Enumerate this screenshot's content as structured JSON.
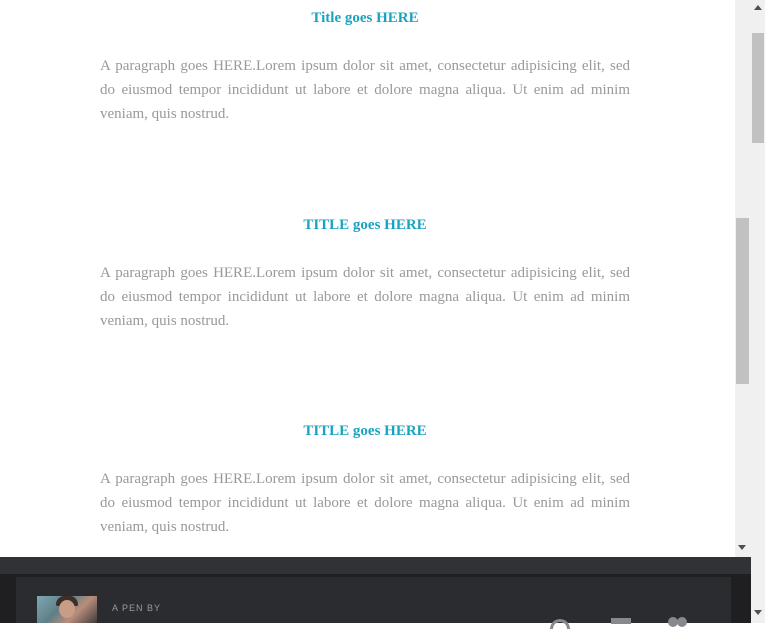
{
  "sections": [
    {
      "title": "Title goes HERE",
      "paragraph": "A paragraph goes HERE.Lorem ipsum dolor sit amet, consectetur adipisicing elit, sed do eiusmod tempor incididunt ut labore et dolore magna aliqua. Ut enim ad minim veniam, quis nostrud."
    },
    {
      "title": "TITLE goes HERE",
      "paragraph": "A paragraph goes HERE.Lorem ipsum dolor sit amet, consectetur adipisicing elit, sed do eiusmod tempor incididunt ut labore et dolore magna aliqua. Ut enim ad minim veniam, quis nostrud."
    },
    {
      "title": "TITLE goes HERE",
      "paragraph": "A paragraph goes HERE.Lorem ipsum dolor sit amet, consectetur adipisicing elit, sed do eiusmod tempor incididunt ut labore et dolore magna aliqua. Ut enim ad minim veniam, quis nostrud."
    }
  ],
  "footer": {
    "pen_by_label": "A PEN BY"
  },
  "colors": {
    "title": "#1aa3c0",
    "paragraph": "#999999",
    "footer_bg": "#2b2c30"
  },
  "icons": [
    "avatar",
    "views-icon",
    "comments-icon",
    "hearts-icon"
  ]
}
